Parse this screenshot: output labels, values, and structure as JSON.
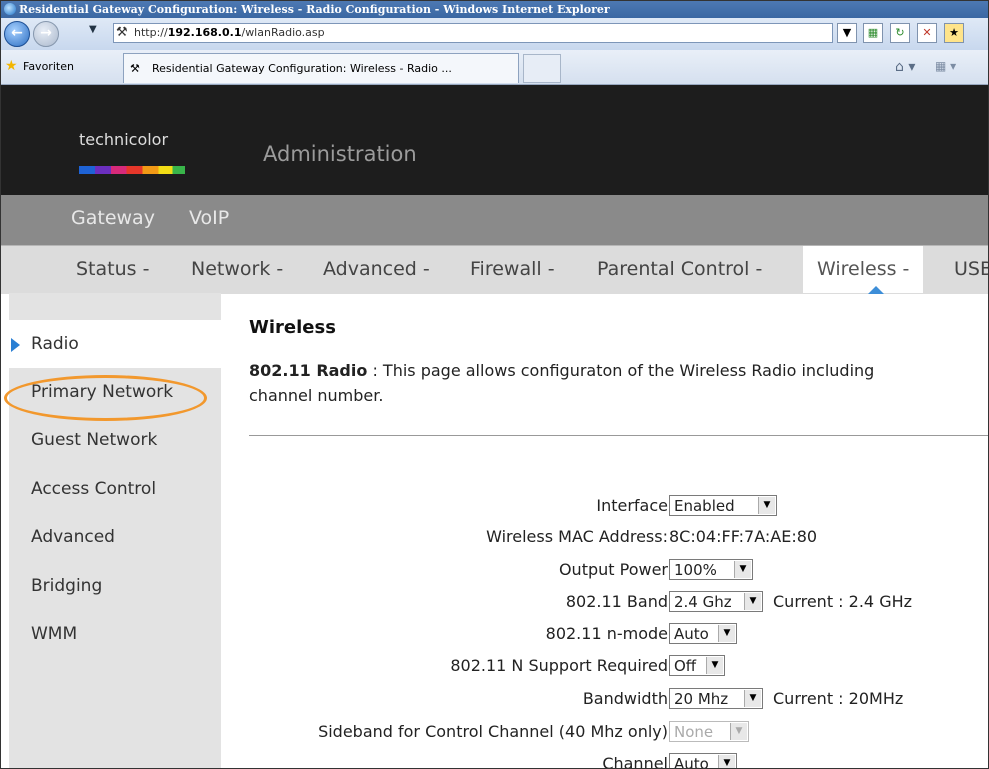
{
  "browser": {
    "window_title": "Residential Gateway Configuration: Wireless - Radio Configuration - Windows Internet Explorer",
    "url_prefix": "http://",
    "url_host": "192.168.0.1",
    "url_path": "/wlanRadio.asp",
    "favorites_label": "Favoriten",
    "tab_title": "Residential Gateway Configuration: Wireless - Radio ..."
  },
  "header": {
    "logo_text": "technicolor",
    "title": "Administration"
  },
  "nav_primary": [
    "Gateway",
    "VoIP"
  ],
  "nav_secondary": [
    "Status -",
    "Network -",
    "Advanced -",
    "Firewall -",
    "Parental Control -",
    "Wireless -",
    "USB"
  ],
  "sidebar": {
    "items": [
      "Radio",
      "Primary Network",
      "Guest Network",
      "Access Control",
      "Advanced",
      "Bridging",
      "WMM"
    ],
    "active_index": 0,
    "highlighted_index": 1
  },
  "content": {
    "title": "Wireless",
    "desc_bold": "802.11 Radio",
    "desc_line1": " :  This page allows configuraton of the Wireless Radio including",
    "desc_line2": "channel number.",
    "fields": {
      "interface_label": "Interface",
      "interface_value": "Enabled",
      "mac_label": "Wireless MAC Address:",
      "mac_value": "8C:04:FF:7A:AE:80",
      "output_power_label": "Output Power",
      "output_power_value": "100%",
      "band_label": "802.11 Band",
      "band_value": "2.4 Ghz",
      "band_current": "Current :  2.4 GHz",
      "nmode_label": "802.11 n-mode",
      "nmode_value": "Auto",
      "nsupport_label": "802.11 N Support Required",
      "nsupport_value": "Off",
      "bandwidth_label": "Bandwidth",
      "bandwidth_value": "20 Mhz",
      "bandwidth_current": "Current :  20MHz",
      "sideband_label": "Sideband for Control Channel (40 Mhz only)",
      "sideband_value": "None",
      "channel_label": "Channel",
      "channel_value": "Auto"
    }
  },
  "colors": {
    "header_bg": "#1d1d1d",
    "nav1_bg": "#8a8a8a",
    "nav2_bg": "#dcdcdc",
    "sidebar_bg": "#e3e3e3",
    "accent_blue": "#2a7fd3",
    "highlight_orange": "#f2982d"
  }
}
